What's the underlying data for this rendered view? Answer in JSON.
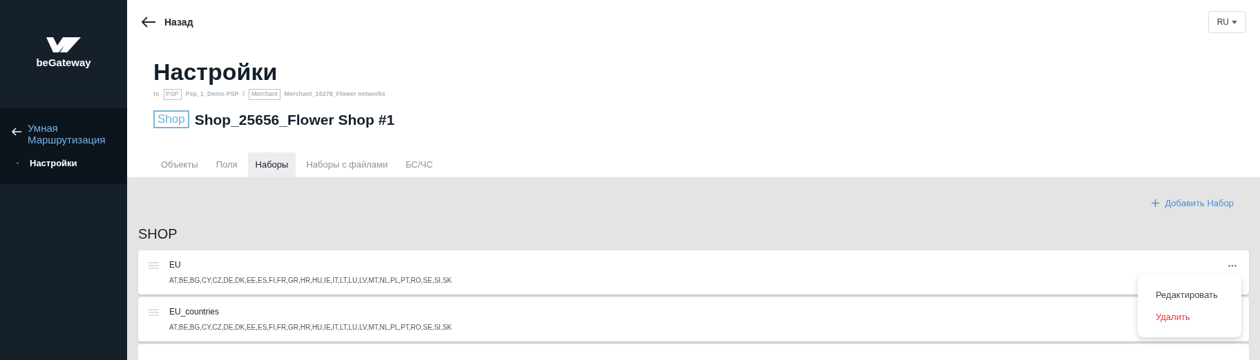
{
  "sidebar": {
    "logo_text": "beGateway",
    "section": {
      "title": "Умная Маршрутизация",
      "items": [
        {
          "label": "Настройки",
          "selected": true
        }
      ]
    }
  },
  "header": {
    "back": "Назад",
    "language": "RU"
  },
  "page": {
    "title": "Настройки",
    "breadcrumb": [
      {
        "tag": "PSP",
        "name": "Psp_1_Demo PSP"
      },
      {
        "tag": "Merchant",
        "name": "Merchant_16278_Flower networks"
      }
    ],
    "breadcrumb_prefix": "to",
    "breadcrumb_separator": "/",
    "entity_tag": "Shop",
    "entity_name": "Shop_25656_Flower Shop #1"
  },
  "tabs": [
    {
      "label": "Объекты",
      "selected": false
    },
    {
      "label": "Поля",
      "selected": false
    },
    {
      "label": "Наборы",
      "selected": true
    },
    {
      "label": "Наборы с файлами",
      "selected": false
    },
    {
      "label": "БС/ЧС",
      "selected": false
    }
  ],
  "add_button": "Добавить Набор",
  "section_title": "SHOP",
  "sets": [
    {
      "name": "EU",
      "values": "AT,BE,BG,CY,CZ,DE,DK,EE,ES,FI,FR,GR,HR,HU,IE,IT,LT,LU,LV,MT,NL,PL,PT,RO,SE,SI,SK"
    },
    {
      "name": "EU_countries",
      "values": "AT,BE,BG,CY,CZ,DE,DK,EE,ES,FI,FR,GR,HR,HU,IE,IT,LT,LU,LV,MT,NL,PL,PT,RO,SE,SI,SK"
    }
  ],
  "context_menu": {
    "items": [
      {
        "label": "Редактировать",
        "kind": "normal"
      },
      {
        "label": "Удалить",
        "kind": "danger"
      }
    ]
  }
}
